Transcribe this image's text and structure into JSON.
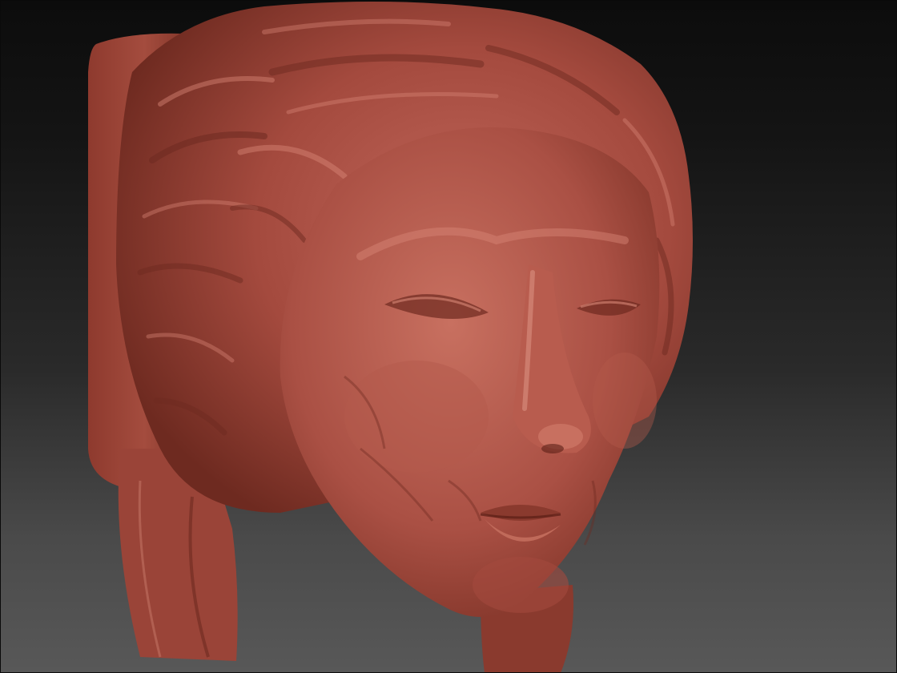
{
  "viewport": {
    "background_top": "#0c0c0c",
    "background_bottom": "#585858"
  },
  "model": {
    "subject": "sculpted-head",
    "material_color": "#a84a3c",
    "highlight_color": "#d98878",
    "shadow_color": "#5a1e16"
  }
}
